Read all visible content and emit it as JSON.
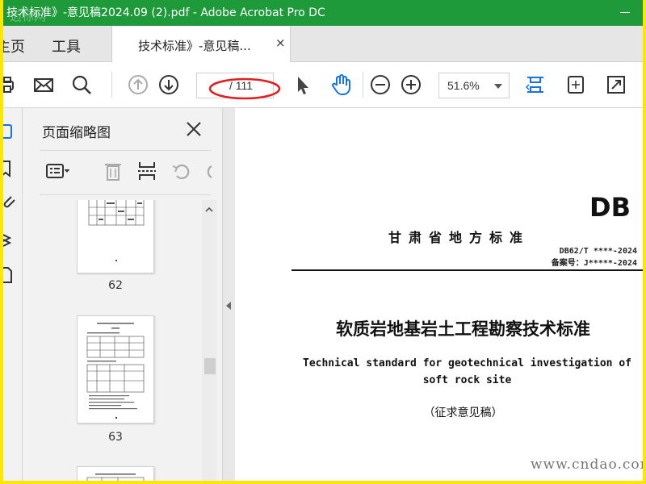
{
  "window": {
    "title": "技术标准》-意见稿2024.09 (2).pdf - Adobe Acrobat Pro DC",
    "watermark": "迈标网"
  },
  "tabs": {
    "home": "主页",
    "tools": "工具",
    "document_tab": "技术标准》-意见稿...",
    "close_glyph": "×"
  },
  "toolbar": {
    "page_current": "",
    "page_total": "/ 111",
    "zoom": "51.6%",
    "accent": "#1473e6",
    "highlight": "#e02020"
  },
  "thumbnail_panel": {
    "title": "页面缩略图",
    "close_glyph": "✕",
    "pages": [
      {
        "label": "62"
      },
      {
        "label": "63"
      },
      {
        "label": ""
      }
    ]
  },
  "document": {
    "code": "DB",
    "issuer": "甘肃省地方标准",
    "standard_no": "DB62/T ****-2024",
    "record_no": "备案号：J*****-2024",
    "title_cn": "软质岩地基岩土工程勘察技术标准",
    "title_en_line1": "Technical standard for geotechnical investigation of",
    "title_en_line2": "soft rock site",
    "draft": "（征求意见稿）",
    "watermark": "www.cndao.com"
  }
}
